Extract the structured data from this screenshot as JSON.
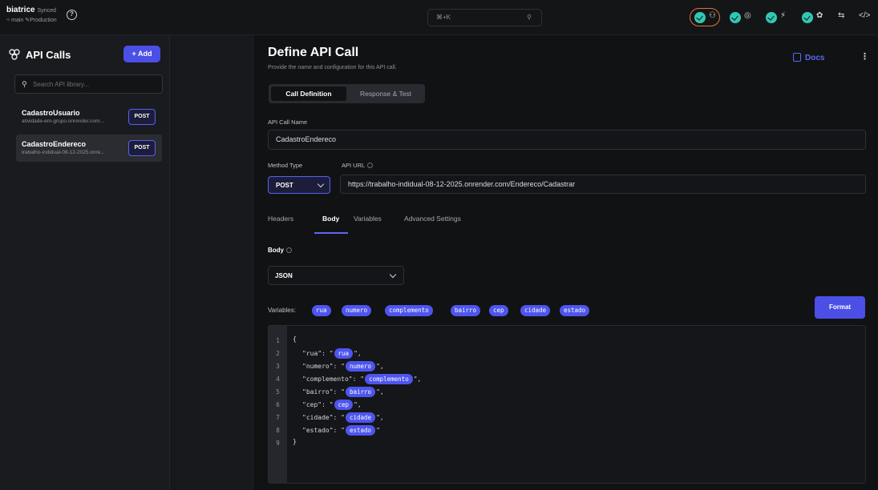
{
  "topbar": {
    "brand": "biatrice",
    "brand_tag": "Synced",
    "branch": "main",
    "environment": "Production",
    "search_shortcut": "⌘+K"
  },
  "sidebar": {
    "title": "API Calls",
    "add_label": "+ Add",
    "search_placeholder": "Search API library...",
    "items": [
      {
        "name": "CadastroUsuario",
        "url": "atividade-em-grupo.onrender.com...",
        "method": "POST",
        "selected": false
      },
      {
        "name": "CadastroEndereco",
        "url": "trabalho-indidual-08-12-2025.onre...",
        "method": "POST",
        "selected": true
      }
    ]
  },
  "main": {
    "title": "Define API Call",
    "subtitle": "Provide the name and configuration for this API call.",
    "docs_label": "Docs",
    "segments": [
      "Call Definition",
      "Response & Test"
    ],
    "active_segment": 0,
    "name_label": "API Call Name",
    "name_value": "CadastroEndereco",
    "method_label": "Method Type",
    "method_value": "POST",
    "url_label": "API URL",
    "url_value": "https://trabalho-indidual-08-12-2025.onrender.com/Endereco/Cadastrar",
    "tabs": [
      "Headers",
      "Body",
      "Variables",
      "Advanced Settings"
    ],
    "active_tab": 1,
    "body_label": "Body",
    "body_type": "JSON",
    "variables_label": "Variables:",
    "variables": [
      "rua",
      "numero",
      "complemento",
      "bairro",
      "cep",
      "cidade",
      "estado"
    ],
    "format_label": "Format"
  },
  "editor": {
    "lines": [
      {
        "n": "1",
        "pre": "{",
        "chip": "",
        "post": ""
      },
      {
        "n": "2",
        "pre": "\"rua\": \"",
        "chip": "rua",
        "post": "\","
      },
      {
        "n": "3",
        "pre": "\"numero\": \"",
        "chip": "numero",
        "post": "\","
      },
      {
        "n": "4",
        "pre": "\"complemento\": \"",
        "chip": "complemento",
        "post": "\","
      },
      {
        "n": "5",
        "pre": "\"bairro\": \"",
        "chip": "bairro",
        "post": "\","
      },
      {
        "n": "6",
        "pre": "\"cep\": \"",
        "chip": "cep",
        "post": "\","
      },
      {
        "n": "7",
        "pre": "\"cidade\": \"",
        "chip": "cidade",
        "post": "\","
      },
      {
        "n": "8",
        "pre": "\"estado\": \"",
        "chip": "estado",
        "post": "\""
      },
      {
        "n": "9",
        "pre": "}",
        "chip": "",
        "post": ""
      }
    ]
  },
  "colors": {
    "accent": "#4b4fe6",
    "chip": "#4e55ee",
    "success": "#30c8b4",
    "warning_ring": "#e0703b"
  }
}
